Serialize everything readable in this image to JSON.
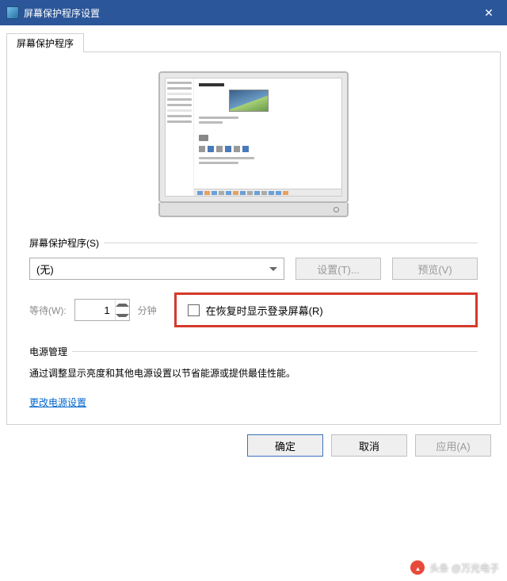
{
  "titlebar": {
    "title": "屏幕保护程序设置"
  },
  "tabs": {
    "main": "屏幕保护程序"
  },
  "section": {
    "screensaver_label": "屏幕保护程序(S)",
    "selected": "(无)",
    "settings_btn": "设置(T)...",
    "preview_btn": "预览(V)",
    "wait_label": "等待(W):",
    "wait_value": "1",
    "wait_unit": "分钟",
    "resume_checkbox_label": "在恢复时显示登录屏幕(R)"
  },
  "power": {
    "heading": "电源管理",
    "description": "通过调整显示亮度和其他电源设置以节省能源或提供最佳性能。",
    "link": "更改电源设置"
  },
  "footer": {
    "ok": "确定",
    "cancel": "取消",
    "apply": "应用(A)"
  },
  "watermark": {
    "text": "头条 @万光电子"
  }
}
